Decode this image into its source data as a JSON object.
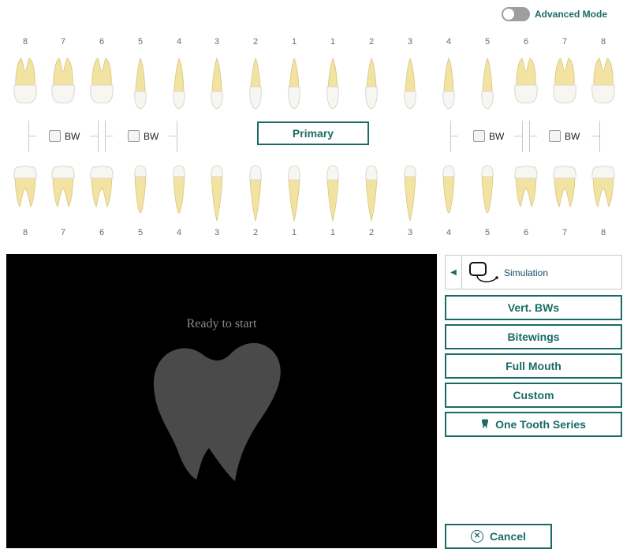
{
  "header": {
    "advanced_mode_label": "Advanced Mode",
    "advanced_mode_on": false
  },
  "tooth_numbers": [
    "8",
    "7",
    "6",
    "5",
    "4",
    "3",
    "2",
    "1",
    "1",
    "2",
    "3",
    "4",
    "5",
    "6",
    "7",
    "8"
  ],
  "bitewing": {
    "label": "BW",
    "checked": [
      false,
      false,
      false,
      false
    ]
  },
  "primary_label": "Primary",
  "viewer": {
    "status": "Ready to start"
  },
  "panel": {
    "sensor_label": "Simulation",
    "buttons": [
      "Vert. BWs",
      "Bitewings",
      "Full Mouth",
      "Custom",
      "One Tooth Series"
    ],
    "cancel_label": "Cancel"
  },
  "colors": {
    "accent": "#1a6b66",
    "tooth": "#f2e3a3",
    "enamel": "#f7f6f0"
  }
}
